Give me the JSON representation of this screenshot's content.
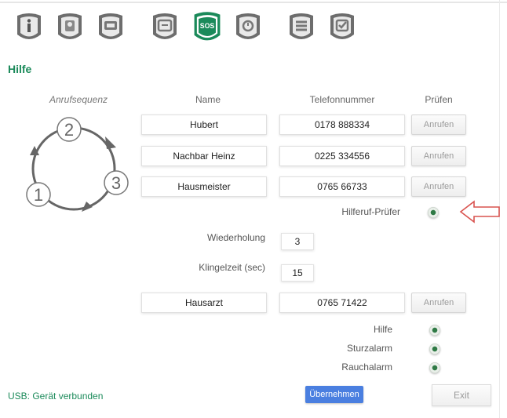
{
  "colors": {
    "accent": "#1b8a5a",
    "primary_button": "#4a7fe0",
    "annotation_arrow": "#d9534f"
  },
  "toolbar": {
    "icons": [
      {
        "name": "info-tab-icon"
      },
      {
        "name": "phonebook-tab-icon"
      },
      {
        "name": "device-tab-icon"
      },
      {
        "name": "clock-tab-icon"
      },
      {
        "name": "sos-tab-icon",
        "label": "SOS",
        "active": true
      },
      {
        "name": "timer-tab-icon"
      },
      {
        "name": "settings-tab-icon"
      },
      {
        "name": "check-tab-icon"
      }
    ]
  },
  "page": {
    "title": "Hilfe"
  },
  "headers": {
    "sequence": "Anrufsequenz",
    "name": "Name",
    "phone": "Telefonnummer",
    "test": "Prüfen"
  },
  "sequence_numbers": [
    "1",
    "2",
    "3"
  ],
  "contacts": [
    {
      "name": "Hubert",
      "phone": "0178 888334",
      "call_label": "Anrufen"
    },
    {
      "name": "Nachbar Heinz",
      "phone": "0225 334556",
      "call_label": "Anrufen"
    },
    {
      "name": "Hausmeister",
      "phone": "0765 66733",
      "call_label": "Anrufen"
    }
  ],
  "helper_check": {
    "label": "Hilferuf-Prüfer",
    "selected": true
  },
  "repeat": {
    "label": "Wiederholung",
    "value": "3"
  },
  "ring_time": {
    "label": "Klingelzeit (sec)",
    "value": "15"
  },
  "doctor": {
    "name": "Hausarzt",
    "phone": "0765 71422",
    "call_label": "Anrufen"
  },
  "alarms": [
    {
      "label": "Hilfe",
      "selected": true
    },
    {
      "label": "Sturzalarm",
      "selected": true
    },
    {
      "label": "Rauchalarm",
      "selected": true
    }
  ],
  "status": {
    "text": "USB: Gerät verbunden"
  },
  "buttons": {
    "apply": "Übernehmen",
    "exit": "Exit"
  }
}
